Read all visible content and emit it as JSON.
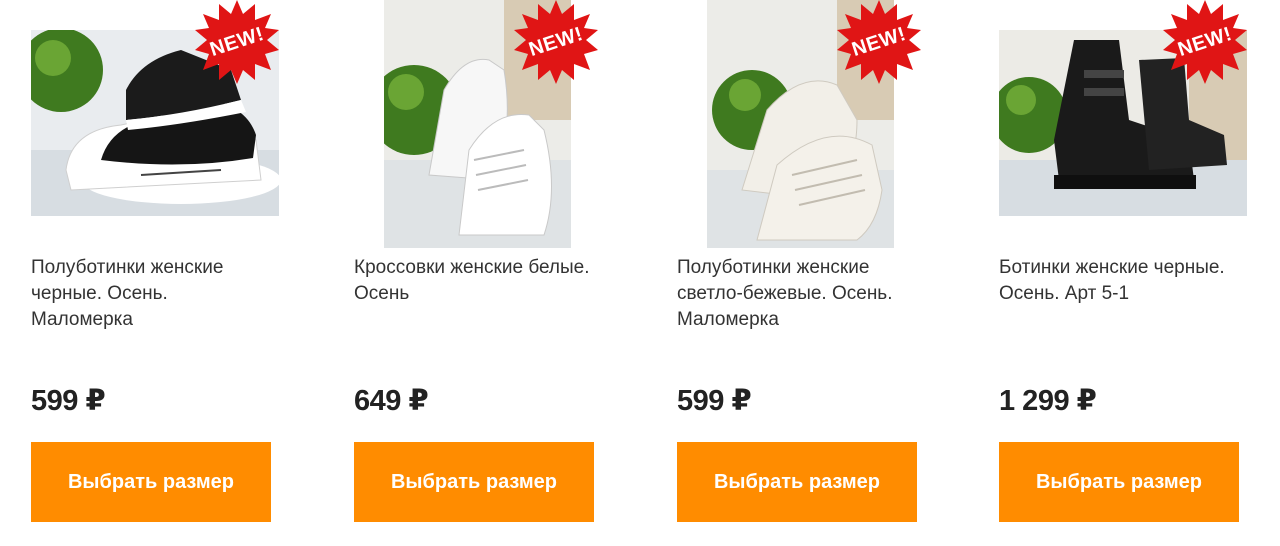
{
  "products": [
    {
      "title": "Полуботинки женские черные. Осень. Маломерка",
      "price": "599 ₽",
      "badge": "NEW!",
      "button": "Выбрать размер"
    },
    {
      "title": "Кроссовки женские белые. Осень",
      "price": "649 ₽",
      "badge": "NEW!",
      "button": "Выбрать размер"
    },
    {
      "title": "Полуботинки женские светло-бежевые. Осень. Маломерка",
      "price": "599 ₽",
      "badge": "NEW!",
      "button": "Выбрать размер"
    },
    {
      "title": "Ботинки женские черные. Осень. Арт 5-1",
      "price": "1 299 ₽",
      "badge": "NEW!",
      "button": "Выбрать размер"
    }
  ],
  "colors": {
    "button": "#ff8c00",
    "badge": "#e01515",
    "text": "#333333"
  }
}
